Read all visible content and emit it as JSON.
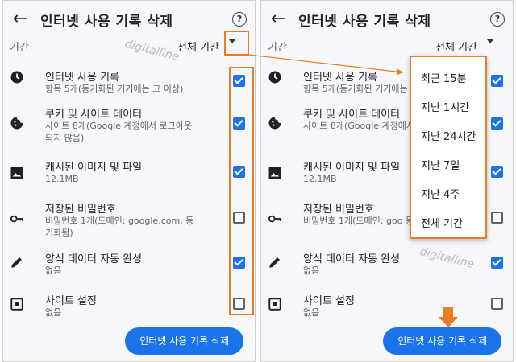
{
  "page": {
    "title": "인터넷 사용 기록 삭제",
    "time_range_label": "기간",
    "time_range_value": "전체 기간",
    "delete_button": "인터넷 사용 기록 삭제",
    "watermark": "digitalline"
  },
  "items": [
    {
      "icon": "clock-icon",
      "title": "인터넷 사용 기록",
      "desc": "항목 5개(동기화된 기기에는 그 이상)",
      "checked": true
    },
    {
      "icon": "cookie-icon",
      "title": "쿠키 및 사이트 데이터",
      "desc": "사이트 8개(Google 계정에서 로그아웃되지 않음)",
      "checked": true
    },
    {
      "icon": "image-icon",
      "title": "캐시된 이미지 및 파일",
      "desc": "12.1MB",
      "checked": true
    },
    {
      "icon": "key-icon",
      "title": "저장된 비밀번호",
      "desc": "비밀번호 1개(도메인: google.com, 동기화됨)",
      "checked": false
    },
    {
      "icon": "pencil-icon",
      "title": "양식 데이터 자동 완성",
      "desc": "없음",
      "checked": true
    },
    {
      "icon": "site-settings-icon",
      "title": "사이트 설정",
      "desc": "없음",
      "checked": false
    }
  ],
  "right_items": [
    {
      "title": "인터넷 사용 기록",
      "desc": "항목 5개(동기화된 기기에는"
    },
    {
      "title": "쿠키 및 사이트 데이터",
      "desc": "사이트 8개(Google 계정에서 않음)"
    },
    {
      "title": "캐시된 이미지 및 파일",
      "desc": "12.1MB"
    },
    {
      "title": "저장된 비밀번호",
      "desc": "비밀번호 1개(도메인: goo 동기화됨)"
    },
    {
      "title": "양식 데이터 자동 완성",
      "desc": "없음"
    },
    {
      "title": "사이트 설정",
      "desc": "없음"
    }
  ],
  "dropdown_options": [
    "최근 15분",
    "지난 1시간",
    "지난 24시간",
    "지난 7일",
    "지난 4주",
    "전체 기간"
  ],
  "colors": {
    "accent": "#1a73e8",
    "highlight": "#ea7d24"
  }
}
